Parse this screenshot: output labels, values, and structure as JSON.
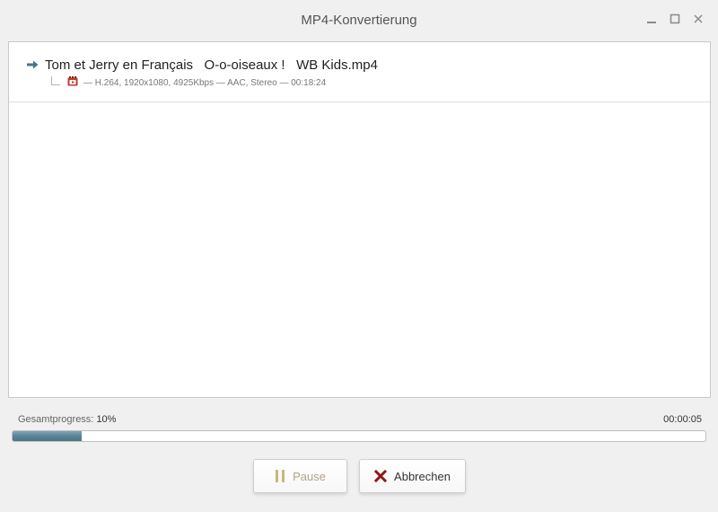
{
  "window": {
    "title": "MP4-Konvertierung"
  },
  "file": {
    "name": "Tom et Jerry en Français   O-o-oiseaux !   WB Kids.mp4",
    "info": "— H.264, 1920x1080, 4925Kbps — AAC, Stereo — 00:18:24"
  },
  "progress": {
    "label": "Gesamtprogress:",
    "percent_text": "10%",
    "percent": 10,
    "elapsed": "00:00:05",
    "fill_color": "#5a8497"
  },
  "buttons": {
    "pause_label": "Pause",
    "cancel_label": "Abbrechen"
  },
  "icons": {
    "minimize": "minimize-icon",
    "maximize": "maximize-icon",
    "close": "close-icon",
    "file_arrow": "arrow-right-icon",
    "video": "video-file-icon",
    "pause": "pause-icon",
    "cancel": "cancel-x-icon"
  },
  "colors": {
    "accent": "#4b7386",
    "cancel_x": "#8b1a1a",
    "pause_icon": "#c8b77a"
  }
}
